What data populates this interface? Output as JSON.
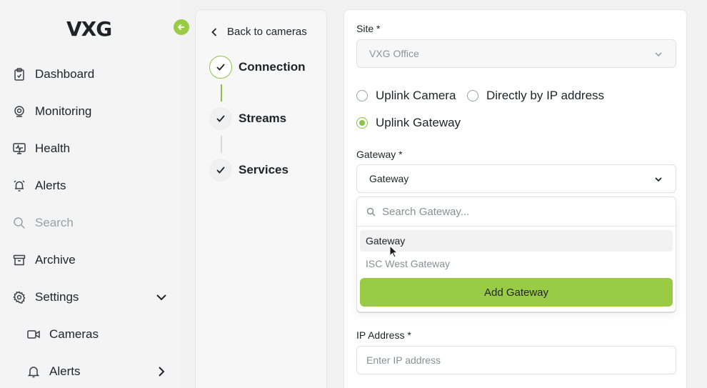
{
  "brand": {
    "logo_text": "VXG",
    "accent": "#9acb44"
  },
  "sidebar": {
    "items": [
      {
        "label": "Dashboard",
        "icon": "clipboard-icon"
      },
      {
        "label": "Monitoring",
        "icon": "webcam-icon"
      },
      {
        "label": "Health",
        "icon": "monitor-heart-icon"
      },
      {
        "label": "Alerts",
        "icon": "alarm-icon"
      },
      {
        "label": "Search",
        "icon": "search-icon"
      },
      {
        "label": "Archive",
        "icon": "archive-box-icon"
      },
      {
        "label": "Settings",
        "icon": "gear-icon"
      }
    ],
    "sub_items": [
      {
        "label": "Cameras",
        "icon": "video-camera-icon"
      },
      {
        "label": "Alerts",
        "icon": "bell-icon"
      }
    ]
  },
  "stepper": {
    "back_label": "Back to cameras",
    "steps": [
      {
        "label": "Connection",
        "active": true
      },
      {
        "label": "Streams",
        "active": false
      },
      {
        "label": "Services",
        "active": false
      }
    ]
  },
  "form": {
    "site": {
      "label": "Site *",
      "value": "VXG Office"
    },
    "connection_options": [
      {
        "label": "Uplink Camera",
        "selected": false
      },
      {
        "label": "Directly by IP address",
        "selected": false
      },
      {
        "label": "Uplink Gateway",
        "selected": true
      }
    ],
    "gateway": {
      "label": "Gateway *",
      "value": "Gateway",
      "search_placeholder": "Search Gateway...",
      "options": [
        {
          "label": "Gateway",
          "selected": true
        },
        {
          "label": "ISC West Gateway",
          "selected": false
        }
      ],
      "add_label": "Add Gateway"
    },
    "ip_address": {
      "label": "IP Address *",
      "placeholder": "Enter IP address"
    }
  }
}
